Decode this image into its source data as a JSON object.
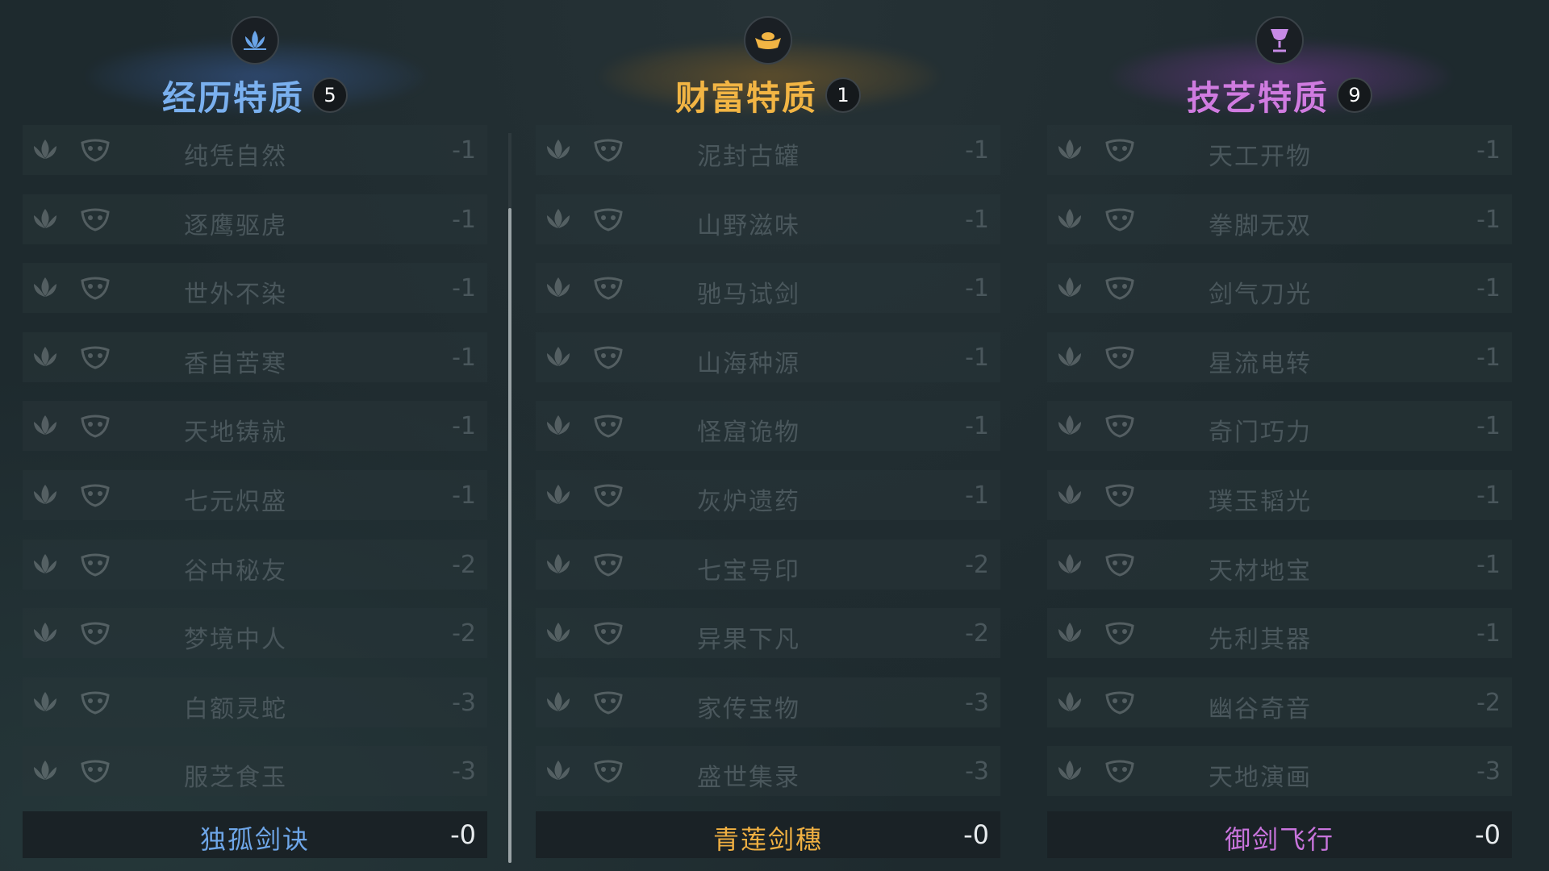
{
  "colors": {
    "experience": "#7ab0ef",
    "wealth": "#f2b544",
    "skill": "#d07be0"
  },
  "columns": [
    {
      "title": "经历特质",
      "count": "5",
      "emblem_icon": "lotus-icon",
      "traits": [
        {
          "name": "纯凭自然",
          "cost": "-1"
        },
        {
          "name": "逐鹰驱虎",
          "cost": "-1"
        },
        {
          "name": "世外不染",
          "cost": "-1"
        },
        {
          "name": "香自苦寒",
          "cost": "-1"
        },
        {
          "name": "天地铸就",
          "cost": "-1"
        },
        {
          "name": "七元炽盛",
          "cost": "-1"
        },
        {
          "name": "谷中秘友",
          "cost": "-2"
        },
        {
          "name": "梦境中人",
          "cost": "-2"
        },
        {
          "name": "白额灵蛇",
          "cost": "-3"
        },
        {
          "name": "服芝食玉",
          "cost": "-3"
        }
      ],
      "selected": {
        "name": "独孤剑诀",
        "cost": "-0"
      }
    },
    {
      "title": "财富特质",
      "count": "1",
      "emblem_icon": "gold-ingot-icon",
      "traits": [
        {
          "name": "泥封古罐",
          "cost": "-1"
        },
        {
          "name": "山野滋味",
          "cost": "-1"
        },
        {
          "name": "驰马试剑",
          "cost": "-1"
        },
        {
          "name": "山海种源",
          "cost": "-1"
        },
        {
          "name": "怪窟诡物",
          "cost": "-1"
        },
        {
          "name": "灰炉遗药",
          "cost": "-1"
        },
        {
          "name": "七宝号印",
          "cost": "-2"
        },
        {
          "name": "异果下凡",
          "cost": "-2"
        },
        {
          "name": "家传宝物",
          "cost": "-3"
        },
        {
          "name": "盛世集录",
          "cost": "-3"
        }
      ],
      "selected": {
        "name": "青莲剑穗",
        "cost": "-0"
      }
    },
    {
      "title": "技艺特质",
      "count": "9",
      "emblem_icon": "goblet-icon",
      "traits": [
        {
          "name": "天工开物",
          "cost": "-1"
        },
        {
          "name": "拳脚无双",
          "cost": "-1"
        },
        {
          "name": "剑气刀光",
          "cost": "-1"
        },
        {
          "name": "星流电转",
          "cost": "-1"
        },
        {
          "name": "奇门巧力",
          "cost": "-1"
        },
        {
          "name": "璞玉韬光",
          "cost": "-1"
        },
        {
          "name": "天材地宝",
          "cost": "-1"
        },
        {
          "name": "先利其器",
          "cost": "-1"
        },
        {
          "name": "幽谷奇音",
          "cost": "-2"
        },
        {
          "name": "天地演画",
          "cost": "-3"
        }
      ],
      "selected": {
        "name": "御剑飞行",
        "cost": "-0"
      }
    }
  ]
}
